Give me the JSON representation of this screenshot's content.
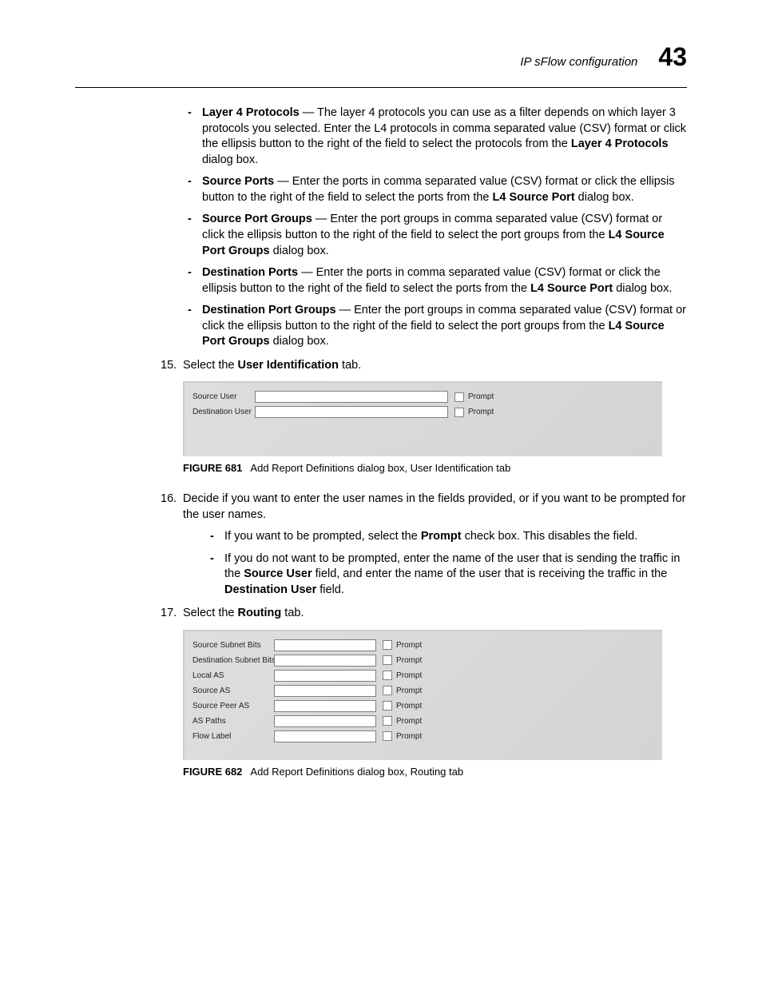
{
  "header": {
    "running_title": "IP sFlow configuration",
    "chapter_number": "43"
  },
  "bullets": {
    "l4_protocols": {
      "term": "Layer 4 Protocols",
      "text_a": " — The layer 4 protocols you can use as a filter depends on which layer 3 protocols you selected. Enter the L4 protocols in comma separated value (CSV) format or click the ellipsis button to the right of the field to select the protocols from the ",
      "bold_b": "Layer 4 Protocols",
      "text_c": " dialog box."
    },
    "source_ports": {
      "term": "Source Ports",
      "text_a": " — Enter the ports in comma separated value (CSV) format or click the ellipsis button to the right of the field to select the ports from the ",
      "bold_b": "L4 Source Port",
      "text_c": " dialog box."
    },
    "source_port_groups": {
      "term": "Source Port Groups",
      "text_a": " — Enter the port groups in comma separated value (CSV) format or click the ellipsis button to the right of the field to select the port groups from the ",
      "bold_b": "L4 Source Port Groups",
      "text_c": " dialog box."
    },
    "destination_ports": {
      "term": "Destination Ports ",
      "text_a": " — Enter the ports in comma separated value (CSV) format or click the ellipsis button to the right of the field to select the ports from the ",
      "bold_b": "L4 Source Port",
      "text_c": " dialog box."
    },
    "destination_port_groups": {
      "term": "Destination Port Groups ",
      "text_a": " — Enter the port groups in comma separated value (CSV) format or click the ellipsis button to the right of the field to select the port groups from the ",
      "bold_b": "L4 Source Port Groups",
      "text_c": " dialog box."
    }
  },
  "step15": {
    "num": "15.",
    "pre": "Select the ",
    "bold": "User Identification",
    "post": " tab."
  },
  "figure681": {
    "rows": [
      {
        "label": "Source User",
        "prompt": "Prompt"
      },
      {
        "label": "Destination User",
        "prompt": "Prompt"
      }
    ],
    "caption_num": "FIGURE 681",
    "caption_text": "Add Report Definitions dialog box, User Identification tab"
  },
  "step16": {
    "num": "16.",
    "text": "Decide if you want to enter the user names in the fields provided, or if you want to be prompted for the user names.",
    "sub_a": {
      "pre": "If you want to be prompted, select the ",
      "bold": "Prompt",
      "post": " check box. This disables the field."
    },
    "sub_b": {
      "pre": "If you do not want to be prompted, enter the name of the user that is sending the traffic in the ",
      "bold1": "Source User",
      "mid": " field, and enter the name of the user that is receiving the traffic in the ",
      "bold2": "Destination User",
      "post": " field."
    }
  },
  "step17": {
    "num": "17.",
    "pre": "Select the ",
    "bold": "Routing",
    "post": " tab."
  },
  "figure682": {
    "rows": [
      {
        "label": "Source Subnet Bits",
        "prompt": "Prompt"
      },
      {
        "label": "Destination Subnet Bits",
        "prompt": "Prompt"
      },
      {
        "label": "Local AS",
        "prompt": "Prompt"
      },
      {
        "label": "Source AS",
        "prompt": "Prompt"
      },
      {
        "label": "Source Peer AS",
        "prompt": "Prompt"
      },
      {
        "label": "AS Paths",
        "prompt": "Prompt"
      },
      {
        "label": "Flow Label",
        "prompt": "Prompt"
      }
    ],
    "caption_num": "FIGURE 682",
    "caption_text": "Add Report Definitions dialog box, Routing tab"
  }
}
